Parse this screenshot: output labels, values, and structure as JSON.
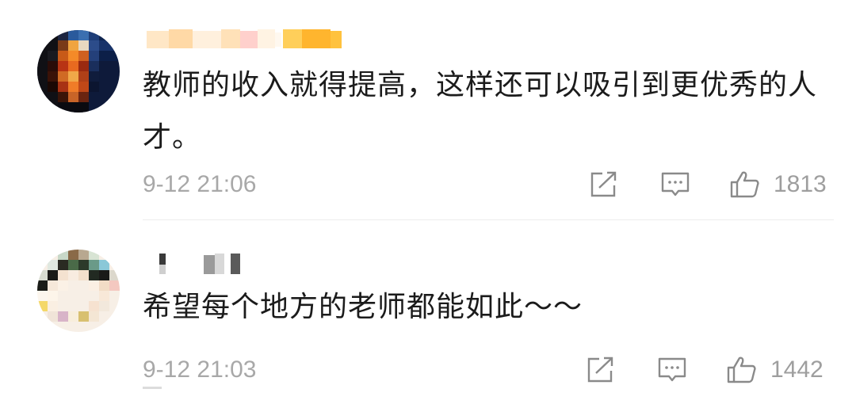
{
  "comments": [
    {
      "text": "教师的收入就得提高，这样还可以吸引到更优秀的人才。",
      "timestamp": "9-12 21:06",
      "like_count": "1813",
      "icons": [
        "share-icon",
        "reply-icon",
        "like-icon"
      ]
    },
    {
      "text": "希望每个地方的老师都能如此～～",
      "timestamp": "9-12 21:03",
      "like_count": "1442",
      "icons": [
        "share-icon",
        "reply-icon",
        "like-icon"
      ]
    }
  ]
}
